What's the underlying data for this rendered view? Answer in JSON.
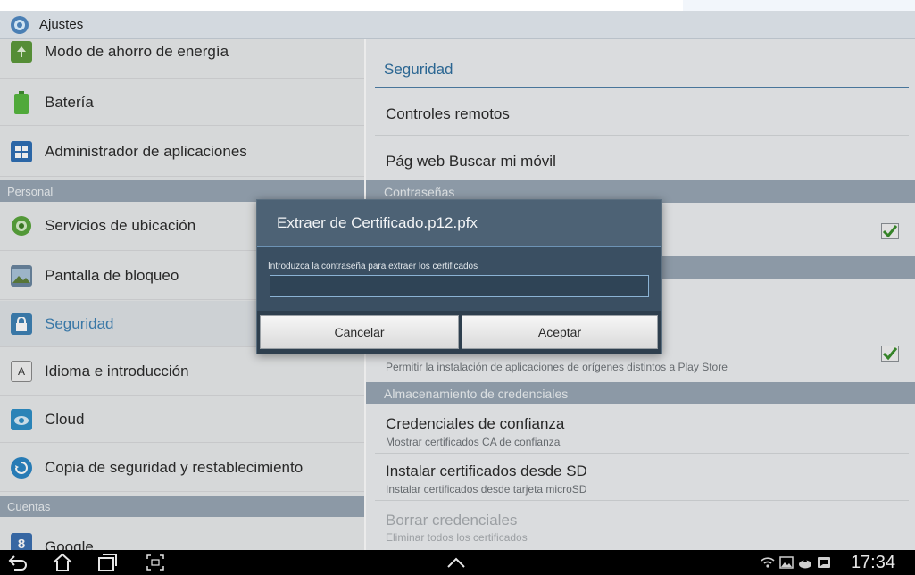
{
  "app": {
    "title": "Ajustes",
    "icon": "settings-gear-icon"
  },
  "left_list": {
    "items": [
      {
        "label": "Modo de ahorro de energía",
        "icon": "power-saving-icon",
        "color": "#5d9a3b"
      },
      {
        "label": "Batería",
        "icon": "battery-icon",
        "color": "#4caf3a"
      },
      {
        "label": "Administrador de aplicaciones",
        "icon": "app-grid-icon",
        "color": "#2f6fb5"
      }
    ],
    "section_personal": "Personal",
    "personal_items": [
      {
        "label": "Servicios de ubicación",
        "icon": "location-icon",
        "color": "#5aa53c"
      },
      {
        "label": "Pantalla de bloqueo",
        "icon": "lock-screen-icon",
        "color": "#6b86a0"
      },
      {
        "label": "Seguridad",
        "icon": "lock-icon",
        "color": "#3e82b5",
        "active": true
      },
      {
        "label": "Idioma e introducción",
        "icon": "keyboard-icon",
        "color": "#7c7c7c"
      },
      {
        "label": "Cloud",
        "icon": "cloud-icon",
        "color": "#2e8fc7"
      },
      {
        "label": "Copia de seguridad y restablecimiento",
        "icon": "backup-icon",
        "color": "#2b86c5"
      }
    ],
    "section_accounts": "Cuentas",
    "account_items": [
      {
        "label": "Google",
        "icon": "google-icon",
        "color": "#3b6fb0"
      }
    ]
  },
  "detail": {
    "title": "Seguridad",
    "items": {
      "remote_controls": "Controles remotos",
      "find_my_mobile": "Pág web Buscar mi móvil",
      "section_passwords": "Contraseñas",
      "unknown_sources_sub": "Permitir la instalación de aplicaciones de orígenes distintos a Play Store",
      "section_credentials": "Almacenamiento de credenciales",
      "trusted_credentials": "Credenciales de confianza",
      "trusted_credentials_sub": "Mostrar certificados CA de confianza",
      "install_from_sd": "Instalar certificados desde SD",
      "install_from_sd_sub": "Instalar certificados desde tarjeta microSD",
      "clear_credentials": "Borrar credenciales",
      "clear_credentials_sub": "Eliminar todos los certificados"
    },
    "accent": "#2f6f9f",
    "section_color": "#98a7b5"
  },
  "dialog": {
    "title": "Extraer de Certificado.p12.pfx",
    "message": "Introduzca la contraseña para extraer los certificados",
    "password_value": "",
    "cancel_label": "Cancelar",
    "accept_label": "Aceptar",
    "bg": "#3a4f62"
  },
  "system_bar": {
    "time": "17:34",
    "nav": [
      "back-icon",
      "home-icon",
      "recent-apps-icon",
      "screenshot-icon"
    ],
    "status_icons": [
      "wifi-icon",
      "gallery-icon",
      "upload-icon",
      "notification-icon"
    ]
  }
}
